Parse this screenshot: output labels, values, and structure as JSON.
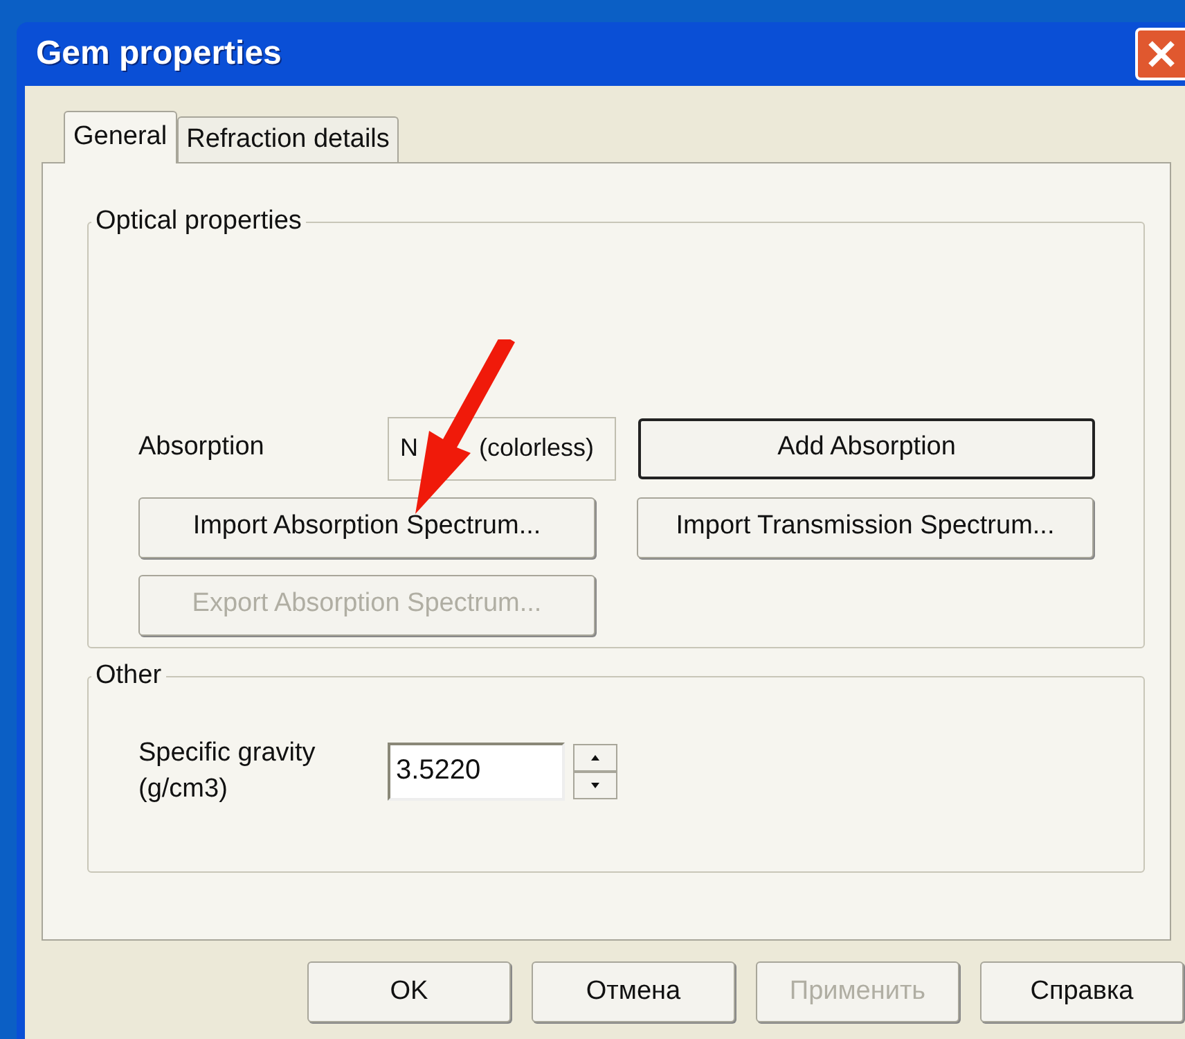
{
  "window": {
    "title": "Gem properties"
  },
  "tabs": [
    {
      "label": "General",
      "selected": true
    },
    {
      "label": "Refraction details",
      "selected": false
    }
  ],
  "optical": {
    "title": "Optical properties",
    "absorption_label": "Absorption",
    "absorption_value": [
      "N",
      "(colorless)"
    ],
    "buttons": [
      {
        "label": "Add Absorption",
        "default": true,
        "disabled": false
      },
      {
        "label": "Import Absorption Spectrum...",
        "default": false,
        "disabled": false
      },
      {
        "label": "Import Transmission Spectrum...",
        "default": false,
        "disabled": false
      },
      {
        "label": "Export Absorption Spectrum...",
        "default": false,
        "disabled": true
      }
    ]
  },
  "other": {
    "title": "Other",
    "label": "Specific gravity\n(g/cm3)",
    "value": "3.5220"
  },
  "buttons": [
    {
      "label": "OK",
      "disabled": false
    },
    {
      "label": "Отмена",
      "disabled": false
    },
    {
      "label": "Применить",
      "disabled": true
    },
    {
      "label": "Справка",
      "disabled": false
    }
  ]
}
